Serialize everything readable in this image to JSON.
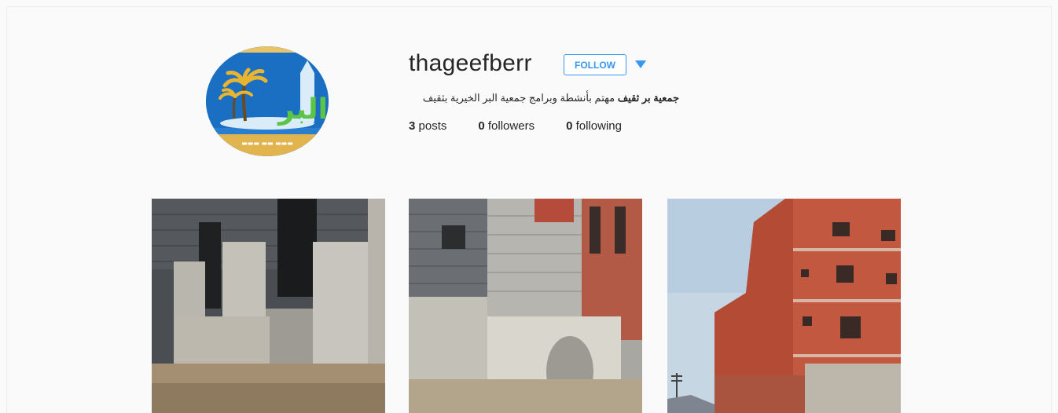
{
  "profile": {
    "username": "thageefberr",
    "follow_label": "FOLLOW",
    "bio_name": "جمعية بر ثقيف",
    "bio_text": " مهتم بأنشطة وبرامج جمعية البر الخيرية بثقيف",
    "avatar_logo_text": "البر",
    "posts_count": "3",
    "posts_label": " posts",
    "followers_count": "0",
    "followers_label": " followers",
    "following_count": "0",
    "following_label": " following"
  },
  "posts": [
    {
      "subject": "building-facade-concrete"
    },
    {
      "subject": "building-block-wall-corner"
    },
    {
      "subject": "red-brick-building-sky"
    }
  ],
  "colors": {
    "accent": "#3897f0",
    "text": "#262626",
    "background": "#fafafa"
  }
}
